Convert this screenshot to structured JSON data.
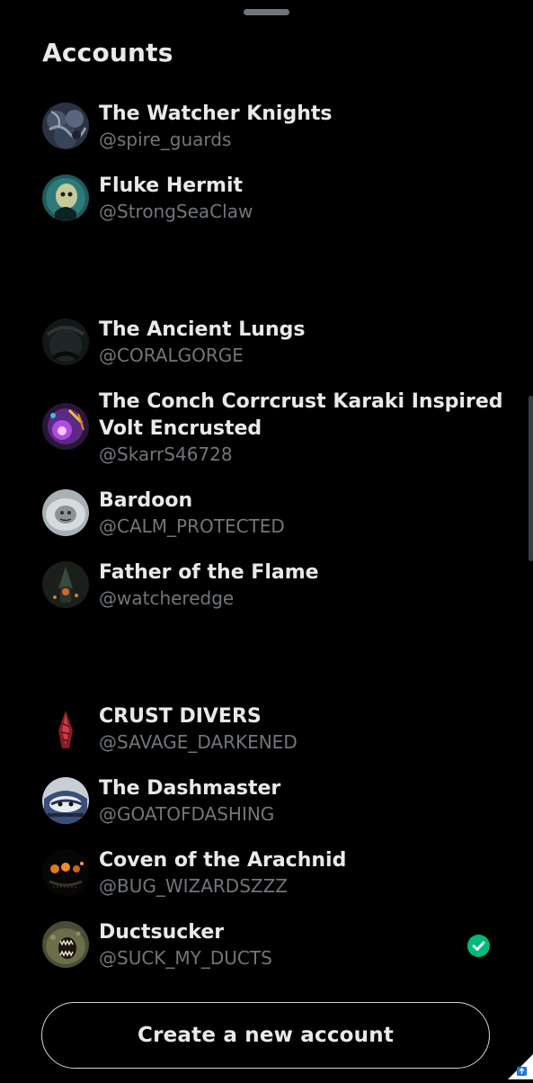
{
  "sheet": {
    "title": "Accounts",
    "create_button_label": "Create a new account"
  },
  "accounts": [
    {
      "name": "The Watcher Knights",
      "handle": "@spire_guards",
      "avatar_icon": "avatar-watcher-knights"
    },
    {
      "name": "Fluke Hermit",
      "handle": "@StrongSeaClaw",
      "avatar_icon": "avatar-fluke-hermit"
    },
    {
      "name": "The Ancient Lungs",
      "handle": "@CORALGORGE",
      "avatar_icon": "avatar-ancient-lungs"
    },
    {
      "name": "The Conch Corrcrust Karaki Inspired",
      "name_line2": "Volt Encrusted",
      "handle": "@SkarrS46728",
      "avatar_icon": "avatar-conch-corrcrust"
    },
    {
      "name": "Bardoon",
      "handle": "@CALM_PROTECTED",
      "avatar_icon": "avatar-bardoon"
    },
    {
      "name": "Father of the Flame",
      "handle": "@watcheredge",
      "avatar_icon": "avatar-father-flame"
    },
    {
      "name": "CRUST DIVERS",
      "handle": "@SAVAGE_DARKENED",
      "avatar_icon": "avatar-crust-divers"
    },
    {
      "name": "The Dashmaster",
      "handle": "@GOATOFDASHING",
      "avatar_icon": "avatar-dashmaster"
    },
    {
      "name": "Coven of the Arachnid",
      "handle": "@BUG_WIZARDSZZZ",
      "avatar_icon": "avatar-coven-arachnid"
    },
    {
      "name": "Ductsucker",
      "handle": "@SUCK_MY_DUCTS",
      "avatar_icon": "avatar-ductsucker",
      "selected": true
    }
  ],
  "colors": {
    "background": "#000000",
    "text_primary": "#e7e9ea",
    "text_secondary": "#71767b",
    "selected_check": "#00ba7c",
    "button_border": "#cfd9de"
  }
}
